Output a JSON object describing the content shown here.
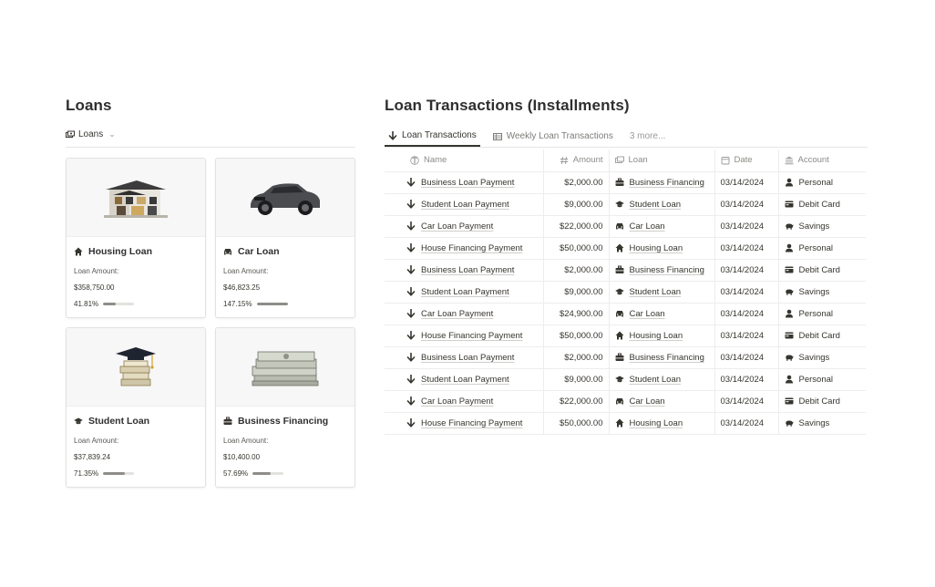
{
  "loans": {
    "title": "Loans",
    "view_label": "Loans",
    "cards": [
      {
        "name": "Housing Loan",
        "icon": "house-icon",
        "amount_label": "Loan Amount:",
        "amount": "$358,750.00",
        "percent": "41.81%",
        "progress": 0.4181
      },
      {
        "name": "Car Loan",
        "icon": "car-icon",
        "amount_label": "Loan Amount:",
        "amount": "$46,823.25",
        "percent": "147.15%",
        "progress": 1.0
      },
      {
        "name": "Student Loan",
        "icon": "graduation-cap-icon",
        "amount_label": "Loan Amount:",
        "amount": "$37,839.24",
        "percent": "71.35%",
        "progress": 0.7135
      },
      {
        "name": "Business Financing",
        "icon": "briefcase-icon",
        "amount_label": "Loan Amount:",
        "amount": "$10,400.00",
        "percent": "57.69%",
        "progress": 0.5769
      }
    ]
  },
  "transactions": {
    "title": "Loan Transactions (Installments)",
    "tabs": [
      {
        "label": "Loan Transactions",
        "active": true
      },
      {
        "label": "Weekly Loan Transactions",
        "active": false
      },
      {
        "label": "3 more...",
        "active": false
      }
    ],
    "columns": {
      "name": "Name",
      "amount": "Amount",
      "loan": "Loan",
      "date": "Date",
      "account": "Account"
    },
    "rows": [
      {
        "name": "Business Loan Payment",
        "amount": "$2,000.00",
        "loan": "Business Financing",
        "loan_icon": "briefcase-icon",
        "date": "03/14/2024",
        "account": "Personal",
        "account_icon": "person-icon"
      },
      {
        "name": "Student Loan Payment",
        "amount": "$9,000.00",
        "loan": "Student Loan",
        "loan_icon": "graduation-cap-icon",
        "date": "03/14/2024",
        "account": "Debit Card",
        "account_icon": "credit-card-icon"
      },
      {
        "name": "Car Loan Payment",
        "amount": "$22,000.00",
        "loan": "Car Loan",
        "loan_icon": "car-icon",
        "date": "03/14/2024",
        "account": "Savings",
        "account_icon": "piggy-bank-icon"
      },
      {
        "name": "House Financing Payment",
        "amount": "$50,000.00",
        "loan": "Housing Loan",
        "loan_icon": "house-icon",
        "date": "03/14/2024",
        "account": "Personal",
        "account_icon": "person-icon"
      },
      {
        "name": "Business Loan Payment",
        "amount": "$2,000.00",
        "loan": "Business Financing",
        "loan_icon": "briefcase-icon",
        "date": "03/14/2024",
        "account": "Debit Card",
        "account_icon": "credit-card-icon"
      },
      {
        "name": "Student Loan Payment",
        "amount": "$9,000.00",
        "loan": "Student Loan",
        "loan_icon": "graduation-cap-icon",
        "date": "03/14/2024",
        "account": "Savings",
        "account_icon": "piggy-bank-icon"
      },
      {
        "name": "Car Loan Payment",
        "amount": "$24,900.00",
        "loan": "Car Loan",
        "loan_icon": "car-icon",
        "date": "03/14/2024",
        "account": "Personal",
        "account_icon": "person-icon"
      },
      {
        "name": "House Financing Payment",
        "amount": "$50,000.00",
        "loan": "Housing Loan",
        "loan_icon": "house-icon",
        "date": "03/14/2024",
        "account": "Debit Card",
        "account_icon": "credit-card-icon"
      },
      {
        "name": "Business Loan Payment",
        "amount": "$2,000.00",
        "loan": "Business Financing",
        "loan_icon": "briefcase-icon",
        "date": "03/14/2024",
        "account": "Savings",
        "account_icon": "piggy-bank-icon"
      },
      {
        "name": "Student Loan Payment",
        "amount": "$9,000.00",
        "loan": "Student Loan",
        "loan_icon": "graduation-cap-icon",
        "date": "03/14/2024",
        "account": "Personal",
        "account_icon": "person-icon"
      },
      {
        "name": "Car Loan Payment",
        "amount": "$22,000.00",
        "loan": "Car Loan",
        "loan_icon": "car-icon",
        "date": "03/14/2024",
        "account": "Debit Card",
        "account_icon": "credit-card-icon"
      },
      {
        "name": "House Financing Payment",
        "amount": "$50,000.00",
        "loan": "Housing Loan",
        "loan_icon": "house-icon",
        "date": "03/14/2024",
        "account": "Savings",
        "account_icon": "piggy-bank-icon"
      }
    ]
  }
}
